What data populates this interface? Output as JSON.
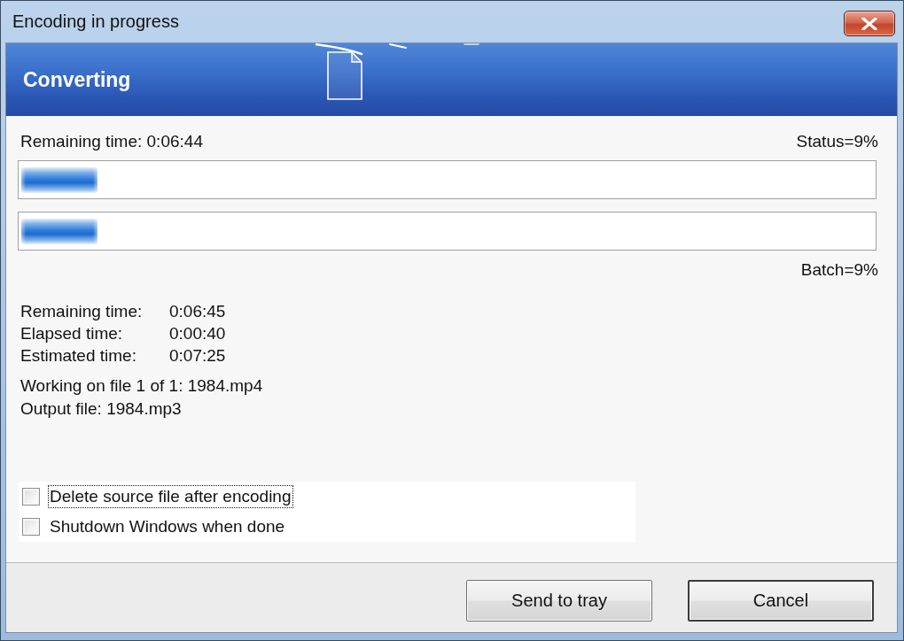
{
  "window": {
    "title": "Encoding in progress"
  },
  "banner": {
    "title": "Converting"
  },
  "current_file": {
    "remaining": "Remaining time: 0:06:44",
    "status": "Status=9%"
  },
  "progress_bars": [
    {
      "level": 0.09
    },
    {
      "level": 0.09
    }
  ],
  "batch": "Batch=9%",
  "times": [
    {
      "label": "Remaining time:",
      "value": "0:06:45"
    },
    {
      "label": "Elapsed time:",
      "value": "0:00:40"
    },
    {
      "label": "Estimated time:",
      "value": "0:07:25"
    }
  ],
  "working_on": "Working on file 1 of 1: 1984.mp4",
  "output_file": "Output file: 1984.mp3",
  "options": [
    {
      "label": "Delete source file after encoding",
      "checked": false,
      "focused": true
    },
    {
      "label": "Shutdown Windows when done",
      "checked": false,
      "focused": false
    }
  ],
  "buttons": [
    {
      "label": "Send to tray",
      "default": false
    },
    {
      "label": "Cancel",
      "default": true
    }
  ]
}
